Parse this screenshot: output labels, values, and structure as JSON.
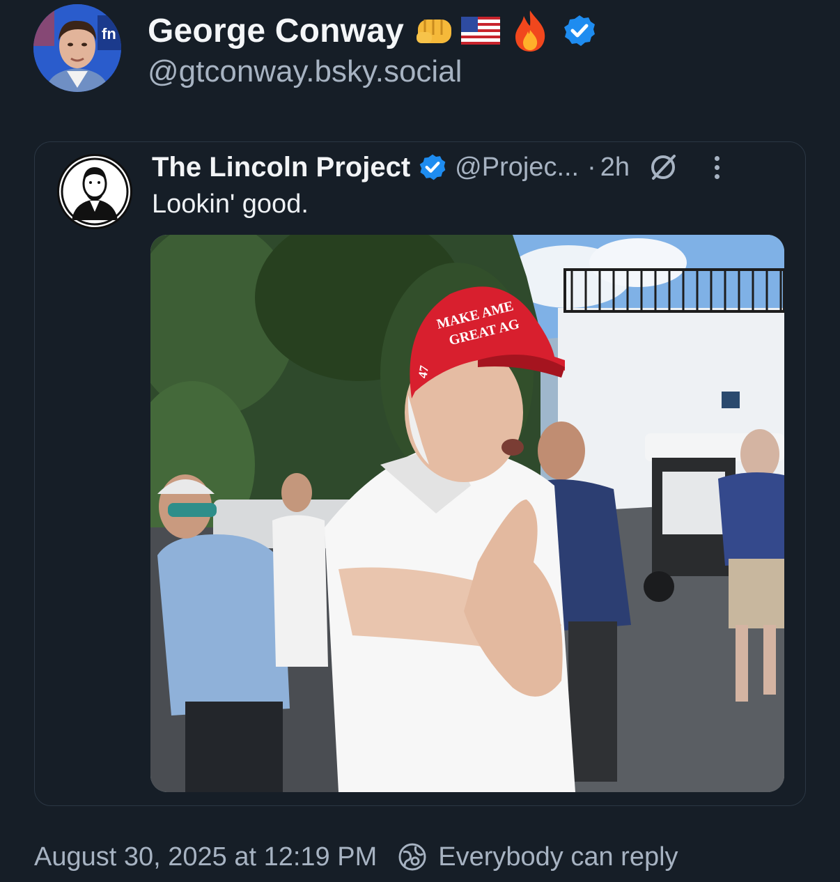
{
  "post": {
    "author": {
      "display_name": "George Conway",
      "handle": "@gtconway.bsky.social",
      "emojis": [
        "oncoming-fist-emoji",
        "us-flag-emoji",
        "fire-emoji"
      ],
      "verified": true
    },
    "quote": {
      "author_name": "The Lincoln Project",
      "author_handle": "@Projec...",
      "separator": "·",
      "time": "2h",
      "verified": true,
      "text": "Lookin' good.",
      "media": {
        "hat_line1": "MAKE AME",
        "hat_line2": "GREAT AG",
        "hat_number": "47"
      }
    },
    "footer": {
      "timestamp": "August 30, 2025 at 12:19 PM",
      "reply_setting": "Everybody can reply"
    }
  },
  "colors": {
    "background": "#161e27",
    "text_primary": "#f1f3f5",
    "text_secondary": "#a7b3c2",
    "verified_blue": "#1e8cf0",
    "card_border": "#2b3744"
  }
}
